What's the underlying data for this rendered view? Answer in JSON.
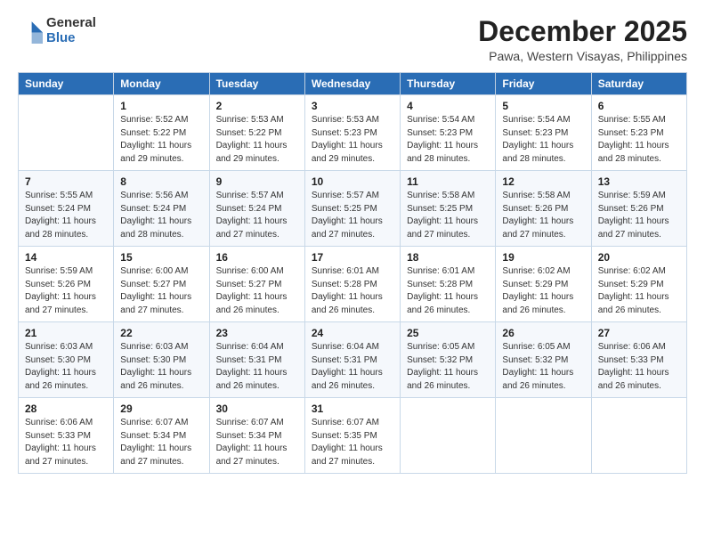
{
  "header": {
    "logo": {
      "general": "General",
      "blue": "Blue"
    },
    "month": "December 2025",
    "location": "Pawa, Western Visayas, Philippines"
  },
  "weekdays": [
    "Sunday",
    "Monday",
    "Tuesday",
    "Wednesday",
    "Thursday",
    "Friday",
    "Saturday"
  ],
  "weeks": [
    [
      {
        "day": "",
        "info": ""
      },
      {
        "day": "1",
        "info": "Sunrise: 5:52 AM\nSunset: 5:22 PM\nDaylight: 11 hours\nand 29 minutes."
      },
      {
        "day": "2",
        "info": "Sunrise: 5:53 AM\nSunset: 5:22 PM\nDaylight: 11 hours\nand 29 minutes."
      },
      {
        "day": "3",
        "info": "Sunrise: 5:53 AM\nSunset: 5:23 PM\nDaylight: 11 hours\nand 29 minutes."
      },
      {
        "day": "4",
        "info": "Sunrise: 5:54 AM\nSunset: 5:23 PM\nDaylight: 11 hours\nand 28 minutes."
      },
      {
        "day": "5",
        "info": "Sunrise: 5:54 AM\nSunset: 5:23 PM\nDaylight: 11 hours\nand 28 minutes."
      },
      {
        "day": "6",
        "info": "Sunrise: 5:55 AM\nSunset: 5:23 PM\nDaylight: 11 hours\nand 28 minutes."
      }
    ],
    [
      {
        "day": "7",
        "info": "Sunrise: 5:55 AM\nSunset: 5:24 PM\nDaylight: 11 hours\nand 28 minutes."
      },
      {
        "day": "8",
        "info": "Sunrise: 5:56 AM\nSunset: 5:24 PM\nDaylight: 11 hours\nand 28 minutes."
      },
      {
        "day": "9",
        "info": "Sunrise: 5:57 AM\nSunset: 5:24 PM\nDaylight: 11 hours\nand 27 minutes."
      },
      {
        "day": "10",
        "info": "Sunrise: 5:57 AM\nSunset: 5:25 PM\nDaylight: 11 hours\nand 27 minutes."
      },
      {
        "day": "11",
        "info": "Sunrise: 5:58 AM\nSunset: 5:25 PM\nDaylight: 11 hours\nand 27 minutes."
      },
      {
        "day": "12",
        "info": "Sunrise: 5:58 AM\nSunset: 5:26 PM\nDaylight: 11 hours\nand 27 minutes."
      },
      {
        "day": "13",
        "info": "Sunrise: 5:59 AM\nSunset: 5:26 PM\nDaylight: 11 hours\nand 27 minutes."
      }
    ],
    [
      {
        "day": "14",
        "info": "Sunrise: 5:59 AM\nSunset: 5:26 PM\nDaylight: 11 hours\nand 27 minutes."
      },
      {
        "day": "15",
        "info": "Sunrise: 6:00 AM\nSunset: 5:27 PM\nDaylight: 11 hours\nand 27 minutes."
      },
      {
        "day": "16",
        "info": "Sunrise: 6:00 AM\nSunset: 5:27 PM\nDaylight: 11 hours\nand 26 minutes."
      },
      {
        "day": "17",
        "info": "Sunrise: 6:01 AM\nSunset: 5:28 PM\nDaylight: 11 hours\nand 26 minutes."
      },
      {
        "day": "18",
        "info": "Sunrise: 6:01 AM\nSunset: 5:28 PM\nDaylight: 11 hours\nand 26 minutes."
      },
      {
        "day": "19",
        "info": "Sunrise: 6:02 AM\nSunset: 5:29 PM\nDaylight: 11 hours\nand 26 minutes."
      },
      {
        "day": "20",
        "info": "Sunrise: 6:02 AM\nSunset: 5:29 PM\nDaylight: 11 hours\nand 26 minutes."
      }
    ],
    [
      {
        "day": "21",
        "info": "Sunrise: 6:03 AM\nSunset: 5:30 PM\nDaylight: 11 hours\nand 26 minutes."
      },
      {
        "day": "22",
        "info": "Sunrise: 6:03 AM\nSunset: 5:30 PM\nDaylight: 11 hours\nand 26 minutes."
      },
      {
        "day": "23",
        "info": "Sunrise: 6:04 AM\nSunset: 5:31 PM\nDaylight: 11 hours\nand 26 minutes."
      },
      {
        "day": "24",
        "info": "Sunrise: 6:04 AM\nSunset: 5:31 PM\nDaylight: 11 hours\nand 26 minutes."
      },
      {
        "day": "25",
        "info": "Sunrise: 6:05 AM\nSunset: 5:32 PM\nDaylight: 11 hours\nand 26 minutes."
      },
      {
        "day": "26",
        "info": "Sunrise: 6:05 AM\nSunset: 5:32 PM\nDaylight: 11 hours\nand 26 minutes."
      },
      {
        "day": "27",
        "info": "Sunrise: 6:06 AM\nSunset: 5:33 PM\nDaylight: 11 hours\nand 26 minutes."
      }
    ],
    [
      {
        "day": "28",
        "info": "Sunrise: 6:06 AM\nSunset: 5:33 PM\nDaylight: 11 hours\nand 27 minutes."
      },
      {
        "day": "29",
        "info": "Sunrise: 6:07 AM\nSunset: 5:34 PM\nDaylight: 11 hours\nand 27 minutes."
      },
      {
        "day": "30",
        "info": "Sunrise: 6:07 AM\nSunset: 5:34 PM\nDaylight: 11 hours\nand 27 minutes."
      },
      {
        "day": "31",
        "info": "Sunrise: 6:07 AM\nSunset: 5:35 PM\nDaylight: 11 hours\nand 27 minutes."
      },
      {
        "day": "",
        "info": ""
      },
      {
        "day": "",
        "info": ""
      },
      {
        "day": "",
        "info": ""
      }
    ]
  ]
}
